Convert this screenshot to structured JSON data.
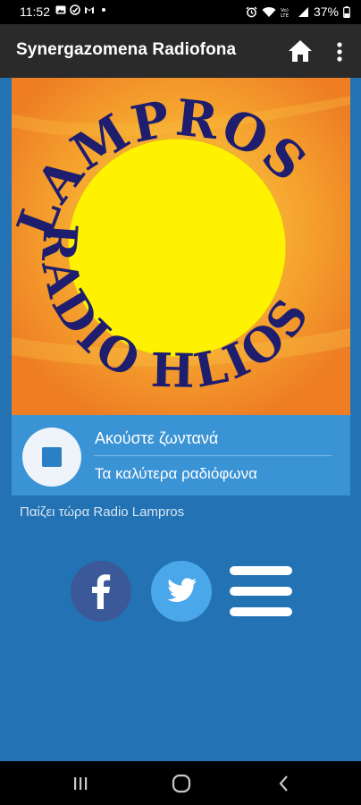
{
  "status_bar": {
    "time": "11:52",
    "battery": "37%",
    "icons_left": [
      "gallery-icon",
      "blocked-icon",
      "gmail-icon",
      "dot-icon"
    ],
    "icons_right": [
      "alarm-icon",
      "wifi-icon",
      "volte-icon",
      "signal-icon",
      "battery-icon"
    ]
  },
  "app_bar": {
    "title": "Synergazomena Radiofona",
    "home_icon": "home-icon",
    "menu_icon": "more-vert-icon"
  },
  "artwork": {
    "logo_text_top": "LAMPROS",
    "logo_text_bottom": "RADIO HLIOS",
    "sun_color": "#fff200",
    "text_color": "#1e1d6e"
  },
  "player": {
    "title": "Ακούστε ζωντανά",
    "subtitle": "Τα καλύτερα ραδιόφωνα",
    "stop_icon": "stop-icon",
    "accent": "#3a93d5"
  },
  "now_playing": "Παίζει τώρα Radio Lampros",
  "social": {
    "facebook_icon": "facebook-icon",
    "twitter_icon": "twitter-icon",
    "menu_icon": "hamburger-menu-icon",
    "facebook_color": "#3b5998",
    "twitter_color": "#4aa8ea"
  },
  "nav_bar": {
    "icons": [
      "recent-apps-icon",
      "home-circle-icon",
      "back-icon"
    ]
  },
  "colors": {
    "background": "#2372b3",
    "app_bar": "#2a2a2a"
  }
}
